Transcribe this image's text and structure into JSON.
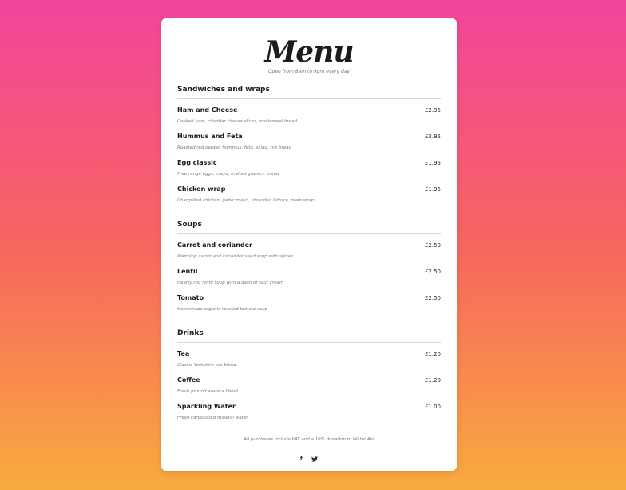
{
  "menu": {
    "title": "Menu",
    "subtitle": "Open from 8am to 9pm every day"
  },
  "sections": [
    {
      "title": "Sandwiches and wraps",
      "items": [
        {
          "name": "Ham and Cheese",
          "price": "£2.95",
          "desc": "Cooked ham, cheddar cheese slices, wholemeal bread"
        },
        {
          "name": "Hummus and Feta",
          "price": "£3.95",
          "desc": "Roasted red pepper hummus, feta, salad, rye bread"
        },
        {
          "name": "Egg classic",
          "price": "£1.95",
          "desc": "Free range eggs, mayo, malted granary bread"
        },
        {
          "name": "Chicken wrap",
          "price": "£1.95",
          "desc": "Chargrilled chicken, garlic mayo, shredded lettuce, plain wrap"
        }
      ]
    },
    {
      "title": "Soups",
      "items": [
        {
          "name": "Carrot and coriander",
          "price": "£2.50",
          "desc": "Warming carrot and coriander seed soup with spices"
        },
        {
          "name": "Lentil",
          "price": "£2.50",
          "desc": "Hearty red lentil soup with a dash of sour cream"
        },
        {
          "name": "Tomato",
          "price": "£2.50",
          "desc": "Homemade organic roasted tomato soup"
        }
      ]
    },
    {
      "title": "Drinks",
      "items": [
        {
          "name": "Tea",
          "price": "£1.20",
          "desc": "Classic Yorkshire tea blend"
        },
        {
          "name": "Coffee",
          "price": "£1.20",
          "desc": "Fresh ground arabica blend"
        },
        {
          "name": "Sparkling Water",
          "price": "£1.00",
          "desc": "Fresh carbonated mineral water"
        }
      ]
    }
  ],
  "footer": {
    "note": "All purchases include VAT and a 10% donation to Water Aid",
    "social": [
      {
        "icon": "facebook-icon",
        "glyph": "f"
      },
      {
        "icon": "twitter-icon",
        "glyph": "🐦"
      }
    ]
  },
  "colors": {
    "gradient_top": "#f2459c",
    "gradient_mid": "#f7655f",
    "gradient_bottom": "#f8ab3e",
    "card": "#ffffff"
  }
}
